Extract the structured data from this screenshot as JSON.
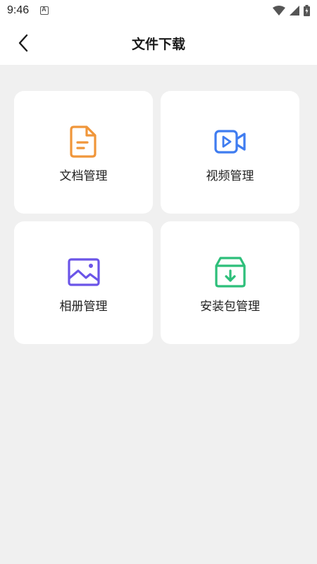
{
  "status_bar": {
    "time": "9:46",
    "icons": [
      "app-notification-icon",
      "wifi-icon",
      "signal-icon",
      "battery-icon"
    ]
  },
  "header": {
    "title": "文件下载",
    "back_icon": "chevron-left-icon"
  },
  "tiles": [
    {
      "label": "文档管理",
      "icon": "document-icon",
      "color": "#F0963A"
    },
    {
      "label": "视频管理",
      "icon": "video-camera-icon",
      "color": "#3F7CF0"
    },
    {
      "label": "相册管理",
      "icon": "image-icon",
      "color": "#6B55E8"
    },
    {
      "label": "安装包管理",
      "icon": "package-download-icon",
      "color": "#2DBF7A"
    }
  ],
  "colors": {
    "background": "#F0F0F0",
    "card": "#FFFFFF",
    "header": "#FFFFFF"
  }
}
